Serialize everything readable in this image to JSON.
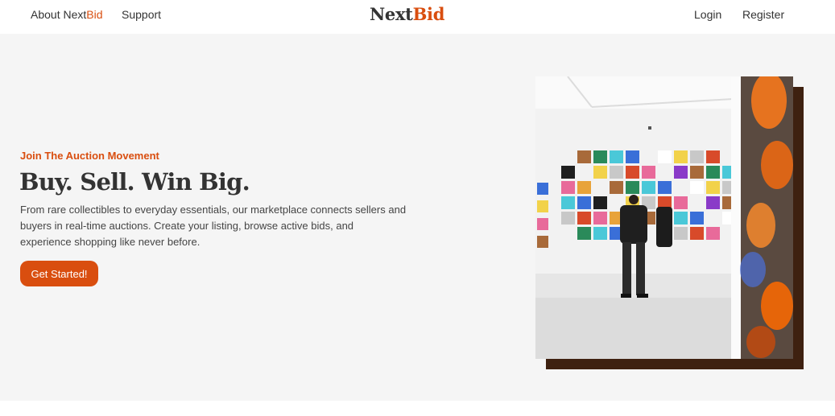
{
  "nav": {
    "about_prefix": "About Next",
    "about_suffix": "Bid",
    "support": "Support",
    "login": "Login",
    "register": "Register",
    "logo_prefix": "Next",
    "logo_suffix": "Bid"
  },
  "hero": {
    "eyebrow": "Join The Auction Movement",
    "headline": "Buy. Sell. Win Big.",
    "description": "From rare collectibles to everyday essentials, our marketplace connects sellers and buyers in real-time auctions. Create your listing, browse active bids, and experience shopping like never before.",
    "cta": "Get Started!"
  },
  "colors": {
    "accent": "#d94e0f",
    "hero_bg": "#f5f5f5",
    "shadow": "#3e2110"
  }
}
